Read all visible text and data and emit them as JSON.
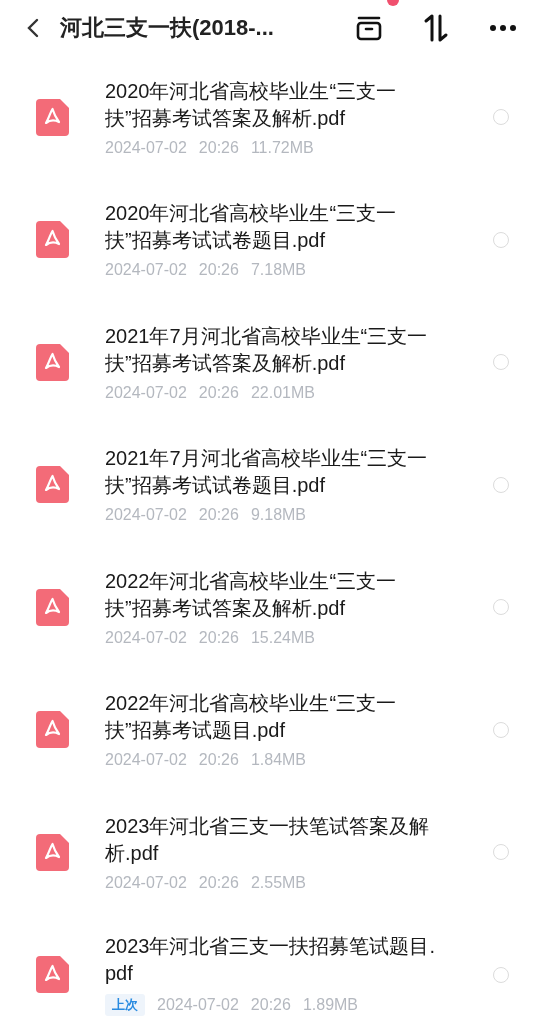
{
  "header": {
    "title": "河北三支一扶(2018-...",
    "has_notification": true
  },
  "files": [
    {
      "name": "2020年河北省高校毕业生“三支一扶”招募考试答案及解析.pdf",
      "date": "2024-07-02",
      "time": "20:26",
      "size": "11.72MB",
      "selected": false
    },
    {
      "name": "2020年河北省高校毕业生“三支一扶”招募考试试卷题目.pdf",
      "date": "2024-07-02",
      "time": "20:26",
      "size": "7.18MB",
      "selected": false
    },
    {
      "name": "2021年7月河北省高校毕业生“三支一扶”招募考试答案及解析.pdf",
      "date": "2024-07-02",
      "time": "20:26",
      "size": "22.01MB",
      "selected": false
    },
    {
      "name": "2021年7月河北省高校毕业生“三支一扶”招募考试试卷题目.pdf",
      "date": "2024-07-02",
      "time": "20:26",
      "size": "9.18MB",
      "selected": false
    },
    {
      "name": "2022年河北省高校毕业生“三支一扶”招募考试答案及解析.pdf",
      "date": "2024-07-02",
      "time": "20:26",
      "size": "15.24MB",
      "selected": false
    },
    {
      "name": "2022年河北省高校毕业生“三支一扶”招募考试题目.pdf",
      "date": "2024-07-02",
      "time": "20:26",
      "size": "1.84MB",
      "selected": false
    },
    {
      "name": "2023年河北省三支一扶笔试答案及解析.pdf",
      "date": "2024-07-02",
      "time": "20:26",
      "size": "2.55MB",
      "selected": false
    },
    {
      "name": "2023年河北省三支一扶招募笔试题目.pdf",
      "badge": "上次",
      "date": "2024-07-02",
      "time": "20:26",
      "size": "1.89MB",
      "selected": false
    }
  ]
}
